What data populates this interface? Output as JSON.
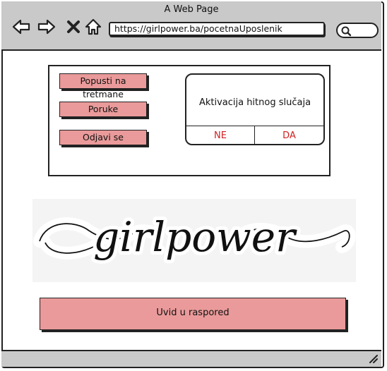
{
  "window": {
    "title": "A Web Page",
    "url": "https://girlpower.ba/pocetnaUposlenik"
  },
  "toolbar": {
    "back_icon": "arrow-left-icon",
    "forward_icon": "arrow-right-icon",
    "close_icon": "close-icon",
    "home_icon": "home-icon",
    "search_icon": "search-icon"
  },
  "sidebar": {
    "buttons": [
      {
        "label": "Popusti na tretmane"
      },
      {
        "label": "Poruke"
      },
      {
        "label": "Odjavi se"
      }
    ]
  },
  "dialog": {
    "message": "Aktivacija hitnog slučaja",
    "no_label": "NE",
    "yes_label": "DA"
  },
  "logo": {
    "text": "girlpower"
  },
  "main": {
    "schedule_label": "Uvid u raspored"
  },
  "colors": {
    "button_fill": "#ea9a9a",
    "dialog_action_text": "#d11f1f",
    "chrome_gray": "#c9c9c9"
  }
}
